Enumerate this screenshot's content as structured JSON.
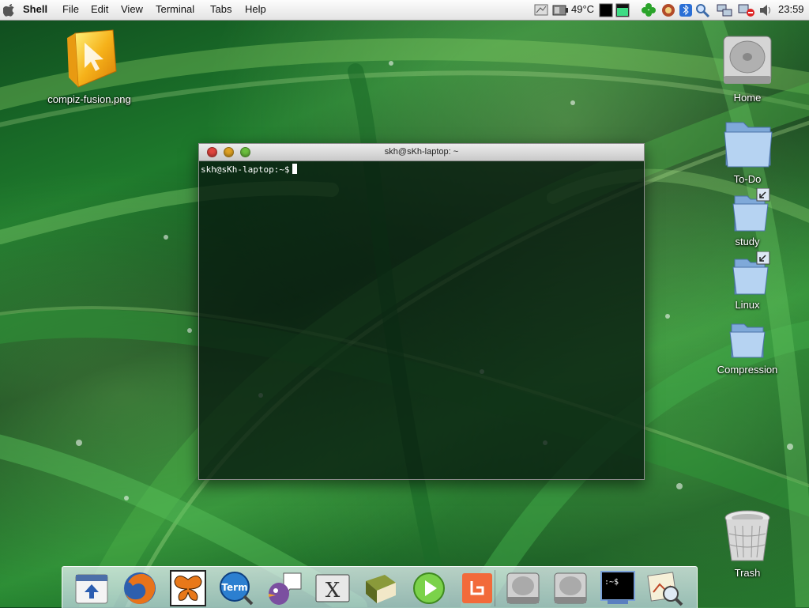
{
  "menubar": {
    "app_name": "Shell",
    "items": [
      {
        "id": "file",
        "label": "File"
      },
      {
        "id": "edit",
        "label": "Edit"
      },
      {
        "id": "view",
        "label": "View"
      },
      {
        "id": "terminal",
        "label": "Terminal"
      },
      {
        "id": "tabs",
        "label": "Tabs"
      },
      {
        "id": "help",
        "label": "Help"
      }
    ],
    "temperature": "49°C",
    "clock": "23:59",
    "tray_icons": [
      "network-monitor-icon",
      "battery-icon",
      "cpu-temp-icon",
      "system-monitor-icon",
      "memory-monitor-icon",
      "clover-icon",
      "package-manager-icon",
      "bluetooth-icon",
      "search-icon",
      "network-icon",
      "network-disconnected-icon",
      "volume-icon"
    ]
  },
  "desktop": {
    "icons": [
      {
        "id": "compiz-fusion",
        "label": "compiz-fusion.png",
        "icon": "image-file-icon"
      },
      {
        "id": "home",
        "label": "Home",
        "icon": "hard-drive-icon"
      },
      {
        "id": "todo",
        "label": "To-Do",
        "icon": "folder-icon"
      },
      {
        "id": "study",
        "label": "study",
        "icon": "folder-alias-icon"
      },
      {
        "id": "linux",
        "label": "Linux",
        "icon": "folder-alias-icon"
      },
      {
        "id": "compression",
        "label": "Compression",
        "icon": "folder-icon"
      },
      {
        "id": "trash",
        "label": "Trash",
        "icon": "trash-icon"
      }
    ]
  },
  "terminal": {
    "title": "skh@sKh-laptop: ~",
    "prompt": "skh@sKh-laptop:~$"
  },
  "dock": {
    "items": [
      "show-desktop-icon",
      "firefox-icon",
      "butterfly-icon",
      "term-icon",
      "pidgin-chat-icon",
      "x-chat-icon",
      "book-icon",
      "media-player-icon",
      "screenlet-icon",
      "drive-icon",
      "drive-icon",
      "terminal-icon",
      "image-viewer-icon"
    ]
  },
  "colors": {
    "close": "#e0443e",
    "minimize": "#dea123",
    "zoom": "#6bbf3e"
  }
}
